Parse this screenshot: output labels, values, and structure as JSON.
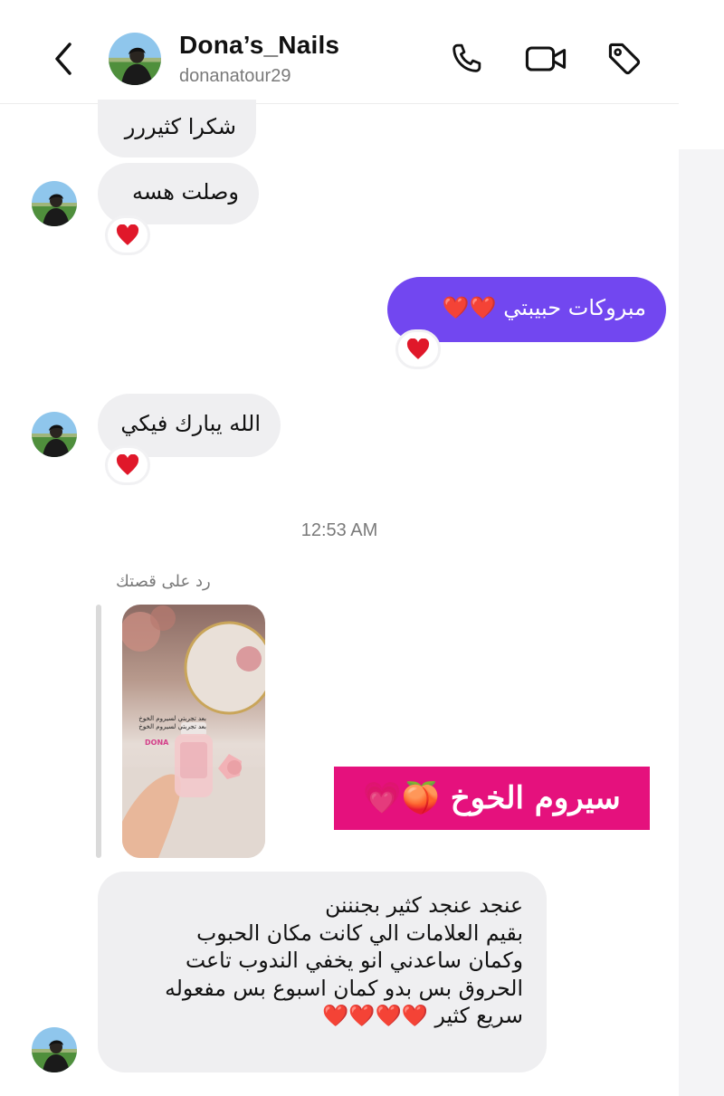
{
  "header": {
    "back_icon": "chevron-left-icon",
    "name": "Dona’s_Nails",
    "username": "donanatour29",
    "icons": [
      "phone-icon",
      "video-camera-icon",
      "tag-icon"
    ]
  },
  "messages": [
    {
      "text": "شكرا كثيررر"
    },
    {
      "text": "وصلت هسه",
      "reaction": "❤️"
    },
    {
      "text": "مبروكات حبيبتي ❤️❤️",
      "reaction": "❤️"
    },
    {
      "text": "الله يبارك فيكي",
      "reaction": "❤️"
    }
  ],
  "timestamp": "12:53 AM",
  "story_reply": {
    "label": "رد على قصتك",
    "story_caption": "بعد تجربتي لسيروم الخوخ بعد تجربتي لسيروم الخوخ",
    "story_brand": "DONA",
    "sticker_text": "سيروم الخوخ 🍑💗"
  },
  "long_message": {
    "lines": [
      "عنجد عنجد كثير بجنننن",
      "بقيم العلامات الي كانت مكان الحبوب",
      "وكمان ساعدني انو يخفي الندوب تاعت",
      "الحروق بس بدو كمان اسبوع بس مفعوله",
      "سريع كثير ❤️❤️❤️❤️"
    ]
  },
  "colors": {
    "accent_purple": "#7247f0",
    "bubble_gray": "#efeff1",
    "sticker_pink": "#e5117d",
    "heart_red": "#e0182a"
  }
}
